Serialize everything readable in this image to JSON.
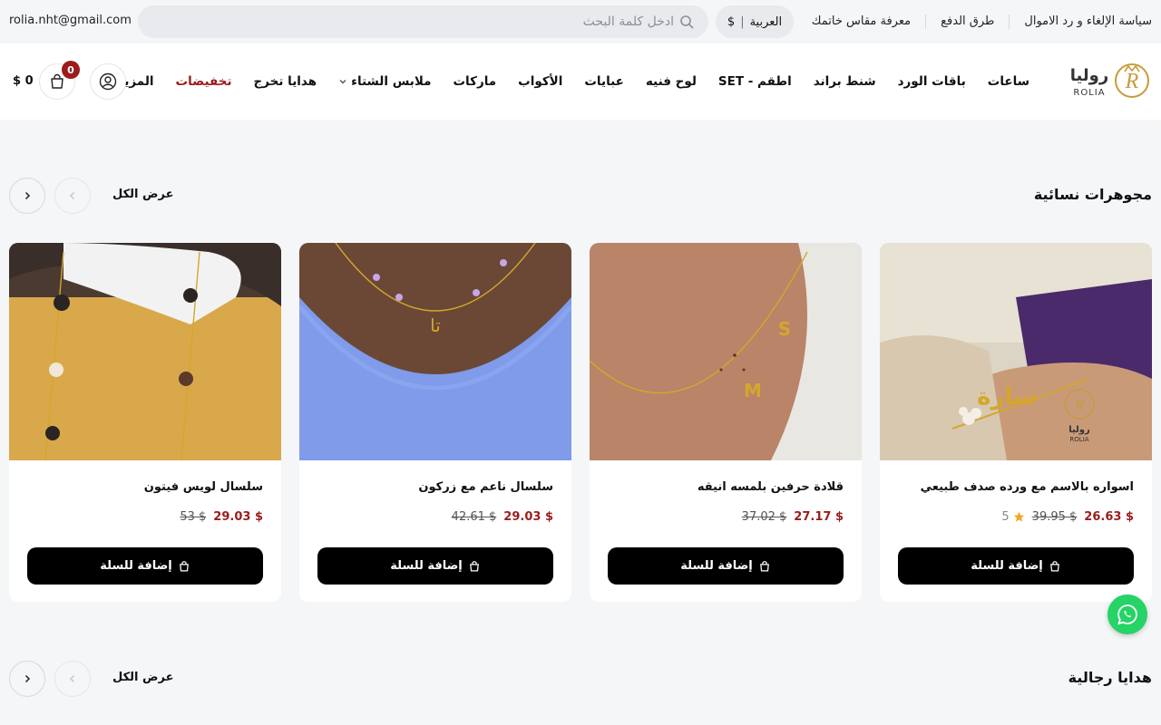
{
  "topbar": {
    "email": "rolia.nht@gmail.com",
    "search_placeholder": "ادخل كلمة البحث",
    "language": "العربية",
    "currency": "$",
    "links": [
      "سياسة الإلغاء و رد الاموال",
      "طرق الدفع",
      "معرفة مقاس خاتمك"
    ]
  },
  "header": {
    "logo_ar": "روليا",
    "logo_en": "ROLIA",
    "nav": [
      {
        "label": "ساعات"
      },
      {
        "label": "باقات الورد"
      },
      {
        "label": "شنط براند"
      },
      {
        "label": "اطقم - SET"
      },
      {
        "label": "لوح فنيه"
      },
      {
        "label": "عبايات"
      },
      {
        "label": "الأكواب"
      },
      {
        "label": "ماركات"
      },
      {
        "label": "ملابس الشتاء"
      },
      {
        "label": "هدايا تخرج"
      },
      {
        "label": "تخفيضات"
      },
      {
        "label": "المزيد"
      }
    ],
    "cart_count": "0",
    "cart_total": "$ 0"
  },
  "sections": [
    {
      "title": "مجوهرات نسائية",
      "view_all": "عرض الكل"
    },
    {
      "title": "هدايا رجالية",
      "view_all": "عرض الكل"
    }
  ],
  "products": [
    {
      "title": "اسواره بالاسم مع ورده صدف طبيعي",
      "price": "$ 26.63",
      "old_price": "$ 39.95",
      "rating": "5",
      "add_label": "إضافة للسلة"
    },
    {
      "title": "قلادة حرفين بلمسه انيقه",
      "price": "$ 27.17",
      "old_price": "$ 37.02",
      "add_label": "إضافة للسلة"
    },
    {
      "title": "سلسال ناعم مع زركون",
      "price": "$ 29.03",
      "old_price": "$ 42.61",
      "add_label": "إضافة للسلة"
    },
    {
      "title": "سلسال لويس فيتون",
      "price": "$ 29.03",
      "old_price": "$ 53",
      "add_label": "إضافة للسلة"
    }
  ],
  "image_text": {
    "bracelet_name": "سارة",
    "necklace1_letters": [
      "S",
      "M"
    ],
    "necklace2_letters": "تا"
  },
  "colors": {
    "accent": "#9b1c1c",
    "button": "#000000",
    "whatsapp": "#25d366",
    "gold": "#c89b3c"
  }
}
